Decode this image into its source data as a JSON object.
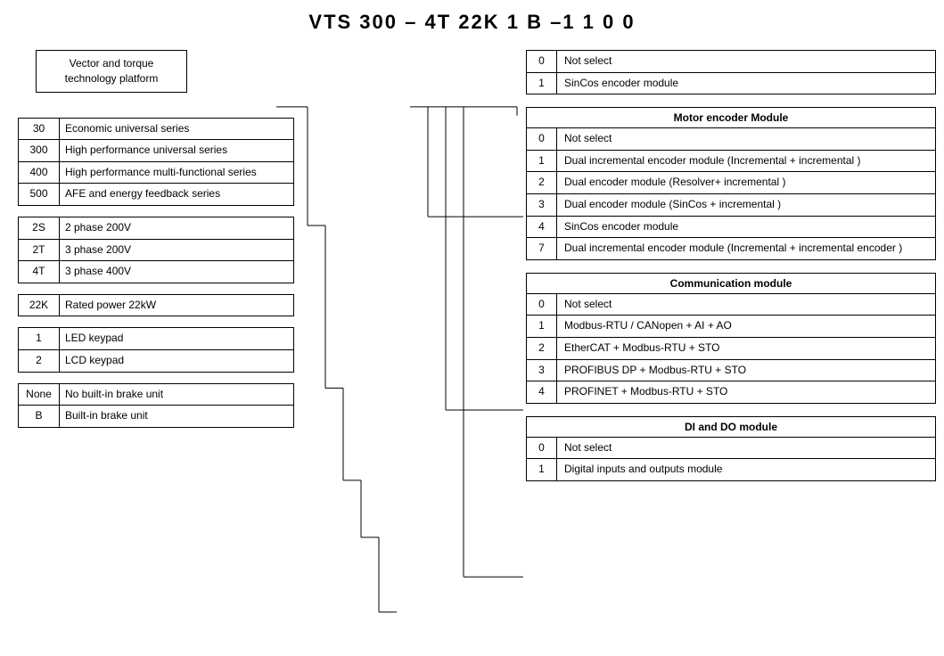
{
  "title": "VTS 300 – 4T 22K 1 B –1 1 0 0",
  "vts_label": "Vector and torque technology platform",
  "series_table": {
    "rows": [
      {
        "code": "30",
        "desc": "Economic universal series"
      },
      {
        "code": "300",
        "desc": "High performance universal series"
      },
      {
        "code": "400",
        "desc": "High performance multi-functional series"
      },
      {
        "code": "500",
        "desc": "AFE and energy feedback series"
      }
    ]
  },
  "phase_table": {
    "rows": [
      {
        "code": "2S",
        "desc": "2 phase 200V"
      },
      {
        "code": "2T",
        "desc": "3 phase 200V"
      },
      {
        "code": "4T",
        "desc": "3 phase 400V"
      }
    ]
  },
  "power_table": {
    "rows": [
      {
        "code": "22K",
        "desc": "Rated power 22kW"
      }
    ]
  },
  "keypad_table": {
    "rows": [
      {
        "code": "1",
        "desc": "LED keypad"
      },
      {
        "code": "2",
        "desc": "LCD keypad"
      }
    ]
  },
  "brake_table": {
    "rows": [
      {
        "code": "None",
        "desc": "No built-in brake unit"
      },
      {
        "code": "B",
        "desc": "Built-in brake unit"
      }
    ]
  },
  "sincos_table": {
    "rows": [
      {
        "code": "0",
        "desc": "Not select"
      },
      {
        "code": "1",
        "desc": "SinCos  encoder module"
      }
    ]
  },
  "motor_encoder_table": {
    "header": "Motor encoder Module",
    "rows": [
      {
        "code": "0",
        "desc": "Not select"
      },
      {
        "code": "1",
        "desc": "Dual incremental encoder module (Incremental + incremental )"
      },
      {
        "code": "2",
        "desc": "Dual encoder module (Resolver+ incremental )"
      },
      {
        "code": "3",
        "desc": "Dual encoder module (SinCos + incremental )"
      },
      {
        "code": "4",
        "desc": "SinCos  encoder module"
      },
      {
        "code": "7",
        "desc": "Dual incremental encoder module (Incremental + incremental encoder )"
      }
    ]
  },
  "communication_table": {
    "header": "Communication module",
    "rows": [
      {
        "code": "0",
        "desc": "Not select"
      },
      {
        "code": "1",
        "desc": "Modbus-RTU / CANopen + AI + AO"
      },
      {
        "code": "2",
        "desc": "EtherCAT + Modbus-RTU + STO"
      },
      {
        "code": "3",
        "desc": "PROFIBUS DP + Modbus-RTU + STO"
      },
      {
        "code": "4",
        "desc": "PROFINET + Modbus-RTU + STO"
      }
    ]
  },
  "di_do_table": {
    "header": "DI and DO module",
    "rows": [
      {
        "code": "0",
        "desc": "Not select"
      },
      {
        "code": "1",
        "desc": "Digital inputs and outputs module"
      }
    ]
  }
}
